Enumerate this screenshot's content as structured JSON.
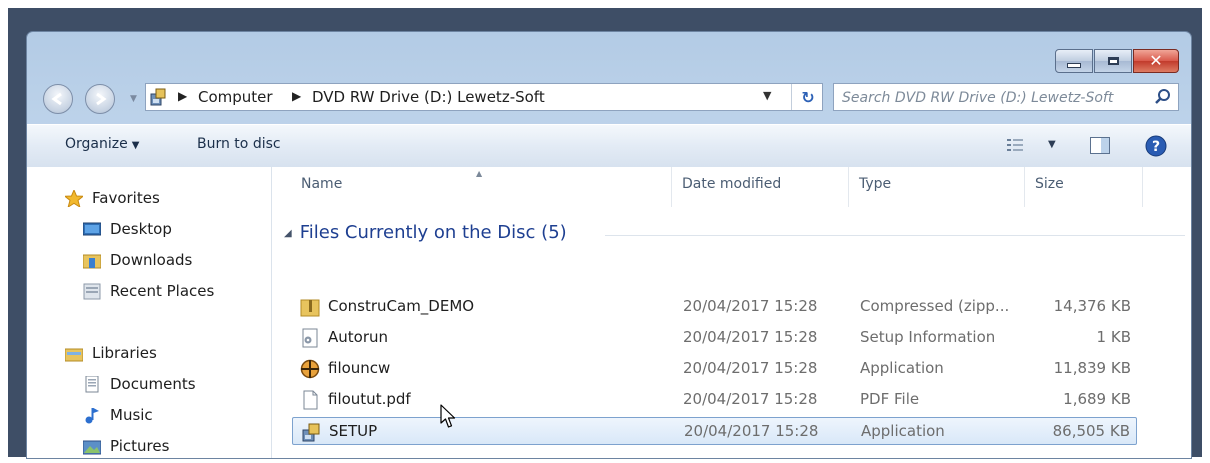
{
  "address": {
    "breadcrumbs": [
      "Computer",
      "DVD RW Drive (D:) Lewetz-Soft"
    ]
  },
  "search": {
    "placeholder": "Search DVD RW Drive (D:) Lewetz-Soft"
  },
  "toolbar": {
    "organize": "Organize",
    "burn": "Burn to disc"
  },
  "nav": {
    "favorites": {
      "label": "Favorites",
      "icon": "star-icon"
    },
    "favorite_items": [
      {
        "label": "Desktop",
        "icon": "desktop-icon"
      },
      {
        "label": "Downloads",
        "icon": "downloads-folder-icon"
      },
      {
        "label": "Recent Places",
        "icon": "recent-places-icon"
      }
    ],
    "libraries": {
      "label": "Libraries",
      "icon": "libraries-icon"
    },
    "library_items": [
      {
        "label": "Documents",
        "icon": "documents-icon"
      },
      {
        "label": "Music",
        "icon": "music-icon"
      },
      {
        "label": "Pictures",
        "icon": "pictures-icon"
      }
    ]
  },
  "columns": {
    "name": "Name",
    "date": "Date modified",
    "type": "Type",
    "size": "Size"
  },
  "group": {
    "label": "Files Currently on the Disc (5)"
  },
  "files": [
    {
      "name": "ConstruCam_DEMO",
      "date": "20/04/2017 15:28",
      "type": "Compressed (zipp...",
      "size": "14,376 KB",
      "icon": "zip-folder-icon"
    },
    {
      "name": "Autorun",
      "date": "20/04/2017 15:28",
      "type": "Setup Information",
      "size": "1 KB",
      "icon": "setup-info-icon"
    },
    {
      "name": "filouncw",
      "date": "20/04/2017 15:28",
      "type": "Application",
      "size": "11,839 KB",
      "icon": "app-crosshair-icon"
    },
    {
      "name": "filoutut.pdf",
      "date": "20/04/2017 15:28",
      "type": "PDF File",
      "size": "1,689 KB",
      "icon": "pdf-file-icon"
    },
    {
      "name": "SETUP",
      "date": "20/04/2017 15:28",
      "type": "Application",
      "size": "86,505 KB",
      "icon": "setup-app-icon",
      "selected": true
    }
  ],
  "colors": {
    "group_text": "#1e3f91",
    "selection": "#d9e8f8",
    "frame": "#3e4e66"
  }
}
